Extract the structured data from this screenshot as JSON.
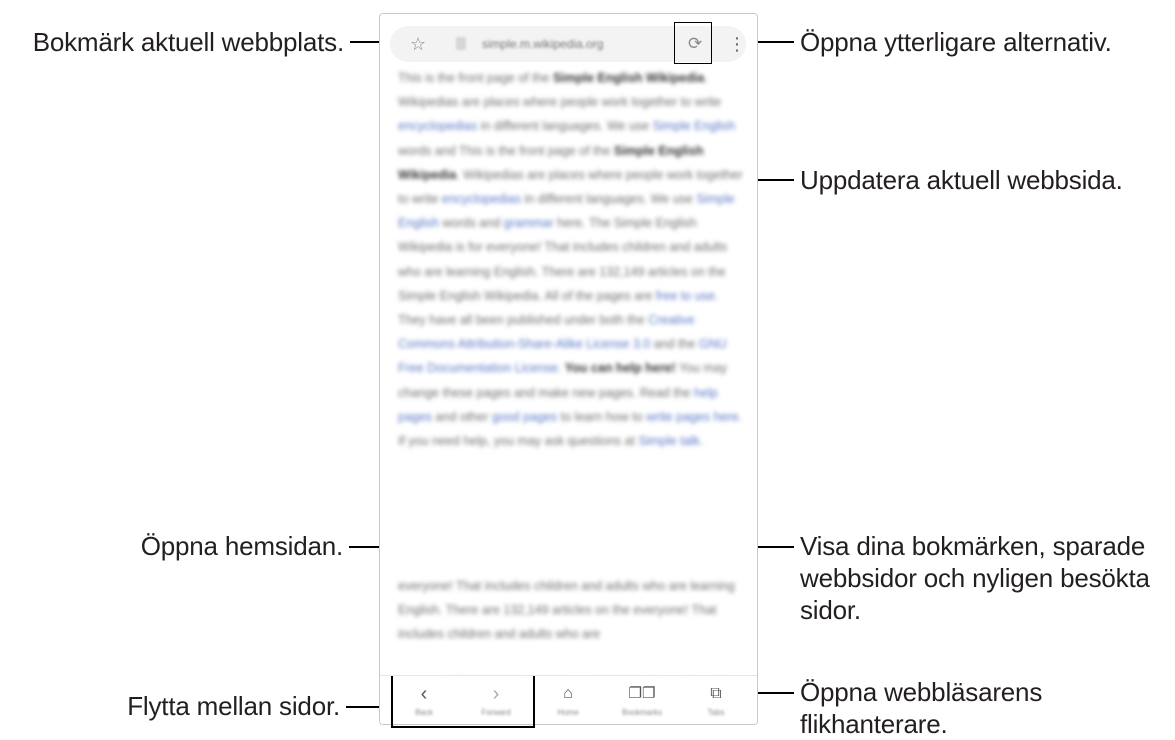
{
  "callouts": {
    "bookmark": "Bokmärk aktuell webbplats.",
    "more_options": "Öppna ytterligare alternativ.",
    "refresh": "Uppdatera aktuell webbsida.",
    "home": "Öppna hemsidan.",
    "bookmarks_line1": "Visa dina bokmärken, sparade",
    "bookmarks_line2": "webbsidor och nyligen besökta",
    "bookmarks_line3": "sidor.",
    "navigate": "Flytta mellan sidor.",
    "tabs_line1": "Öppna webbläsarens",
    "tabs_line2": "flikhanterare."
  },
  "browser": {
    "url": "simple.m.wikipedia.org",
    "icons": {
      "bookmark": "star-icon",
      "refresh": "refresh-icon",
      "more": "more-vertical-icon",
      "back": "chevron-left-icon",
      "forward": "chevron-right-icon",
      "home": "home-icon",
      "bookmarks": "book-icon",
      "tabs": "tabs-icon"
    },
    "nav_labels": {
      "back": "Back",
      "forward": "Forward",
      "home": "Home",
      "bookmarks": "Bookmarks",
      "tabs": "Tabs"
    }
  }
}
